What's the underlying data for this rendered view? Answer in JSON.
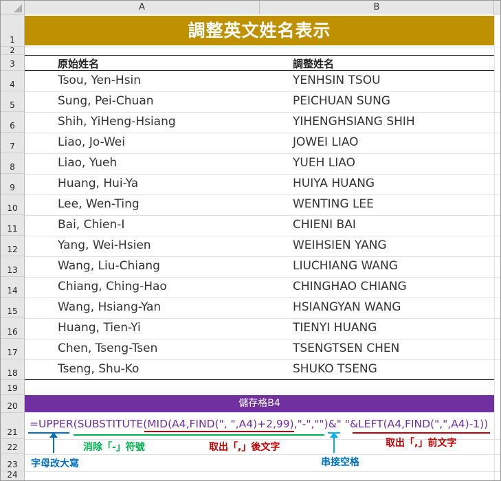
{
  "columns": [
    "A",
    "B"
  ],
  "row_numbers": [
    "1",
    "2",
    "3",
    "4",
    "5",
    "6",
    "7",
    "8",
    "9",
    "10",
    "11",
    "12",
    "13",
    "14",
    "15",
    "16",
    "17",
    "18",
    "19",
    "20",
    "21",
    "22",
    "23",
    "24"
  ],
  "title": "調整英文姓名表示",
  "headers": {
    "original": "原始姓名",
    "adjusted": "調整姓名"
  },
  "rows": [
    {
      "original": "Tsou, Yen-Hsin",
      "adjusted": "YENHSIN TSOU"
    },
    {
      "original": "Sung, Pei-Chuan",
      "adjusted": "PEICHUAN SUNG"
    },
    {
      "original": "Shih, YiHeng-Hsiang",
      "adjusted": "YIHENGHSIANG SHIH"
    },
    {
      "original": "Liao, Jo-Wei",
      "adjusted": "JOWEI LIAO"
    },
    {
      "original": "Liao, Yueh",
      "adjusted": "YUEH LIAO"
    },
    {
      "original": "Huang, Hui-Ya",
      "adjusted": "HUIYA HUANG"
    },
    {
      "original": "Lee, Wen-Ting",
      "adjusted": "WENTING LEE"
    },
    {
      "original": "Bai, Chien-I",
      "adjusted": "CHIENI BAI"
    },
    {
      "original": "Yang, Wei-Hsien",
      "adjusted": "WEIHSIEN YANG"
    },
    {
      "original": "Wang, Liu-Chiang",
      "adjusted": "LIUCHIANG WANG"
    },
    {
      "original": "Chiang, Ching-Hao",
      "adjusted": "CHINGHAO CHIANG"
    },
    {
      "original": "Wang, Hsiang-Yan",
      "adjusted": "HSIANGYAN WANG"
    },
    {
      "original": "Huang, Tien-Yi",
      "adjusted": "TIENYI HUANG"
    },
    {
      "original": "Chen, Tseng-Tsen",
      "adjusted": "TSENGTSEN CHEN"
    },
    {
      "original": "Tseng, Shu-Ko",
      "adjusted": "SHUKO TSENG"
    }
  ],
  "cell_label": "儲存格B4",
  "formula": {
    "p1": "=UPPER(SUBSTITUTE(",
    "p2": "MID(A4,FIND(\", \",A4)+2,99)",
    "p3": ",\"-\",\"\")",
    "p4": "&\" \"&",
    "p5": "LEFT(A4,FIND(\",\",A4)-1)",
    "p6": ")"
  },
  "annotations": {
    "remove_dash": "消除「-」符號",
    "take_after": "取出「,」後文字",
    "take_before": "取出「,」前文字",
    "join_space": "串接空格",
    "uppercase": "字母改大寫"
  },
  "colors": {
    "title_bg": "#bf9000",
    "purple_bar": "#7030a0",
    "blue": "#0070c0",
    "green": "#00b050",
    "red": "#c00000"
  }
}
